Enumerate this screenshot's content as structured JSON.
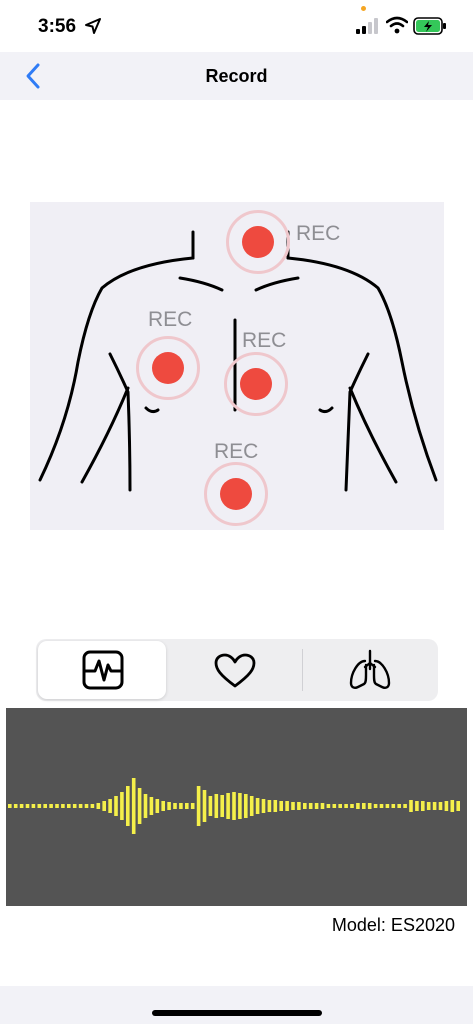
{
  "status_bar": {
    "time": "3:56",
    "privacy_dot_color": "#f5a623",
    "battery_color": "#34c759"
  },
  "nav": {
    "title": "Record",
    "back_icon": "chevron-left-icon",
    "accent": "#2f7cf6"
  },
  "body_map": {
    "points": [
      {
        "id": "upper",
        "label": "REC"
      },
      {
        "id": "left",
        "label": "REC"
      },
      {
        "id": "center",
        "label": "REC"
      },
      {
        "id": "lower",
        "label": "REC"
      }
    ],
    "point_color": "#ee4a3f",
    "ring_color": "#efc7cc"
  },
  "modes": [
    {
      "name": "ecg",
      "icon": "ecg-waveform-icon",
      "selected": true
    },
    {
      "name": "heart",
      "icon": "heart-icon",
      "selected": false
    },
    {
      "name": "lungs",
      "icon": "lungs-icon",
      "selected": false
    }
  ],
  "waveform": {
    "bar_color": "#f5f04a",
    "background": "#545454",
    "amplitudes": [
      2,
      2,
      2,
      2,
      2,
      2,
      2,
      2,
      2,
      2,
      2,
      2,
      2,
      2,
      2,
      3,
      5,
      7,
      10,
      14,
      20,
      28,
      18,
      12,
      9,
      7,
      5,
      4,
      3,
      3,
      3,
      3,
      20,
      16,
      10,
      12,
      11,
      13,
      14,
      13,
      12,
      10,
      8,
      7,
      6,
      6,
      5,
      5,
      4,
      4,
      3,
      3,
      3,
      3,
      2,
      2,
      2,
      2,
      2,
      3,
      3,
      3,
      2,
      2,
      2,
      2,
      2,
      2,
      6,
      5,
      5,
      4,
      4,
      4,
      5,
      6,
      5
    ]
  },
  "footer": {
    "model_text": "Model: ES2020"
  }
}
